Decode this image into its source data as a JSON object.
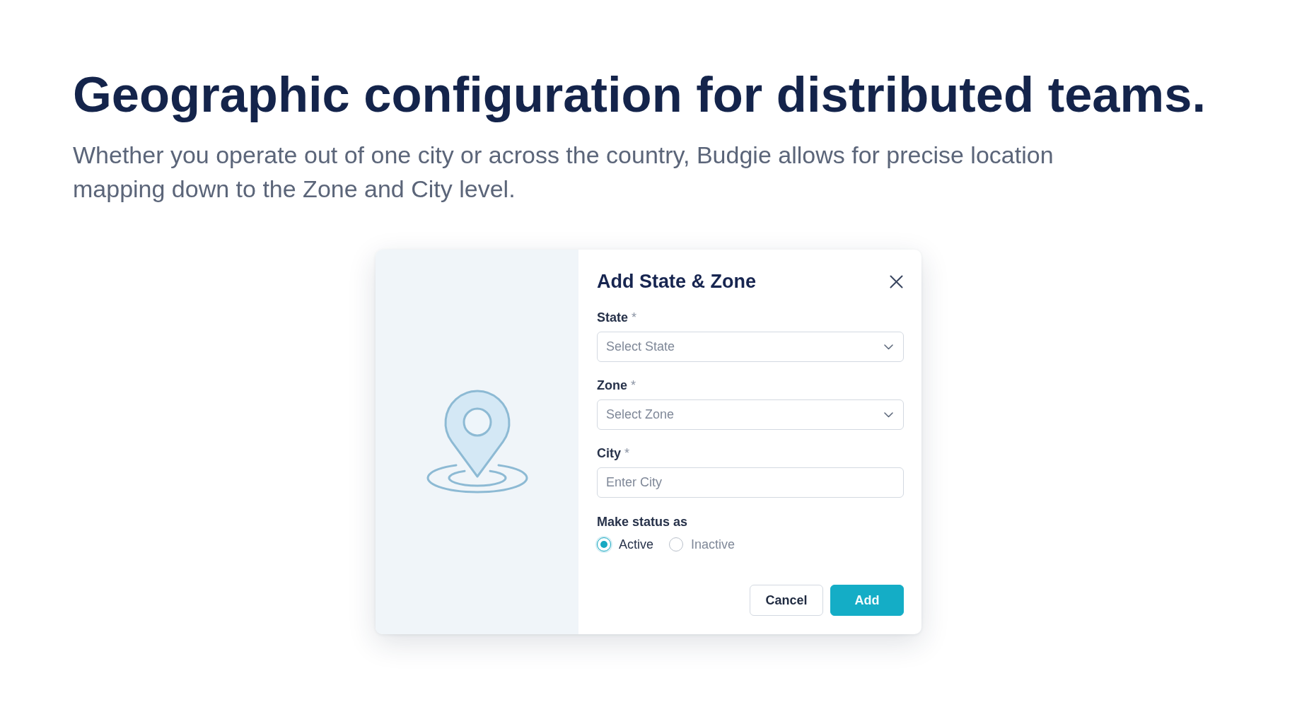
{
  "hero": {
    "title": "Geographic configuration for distributed teams.",
    "subtitle": "Whether you operate out of one city or across the country, Budgie allows for precise location mapping down to the Zone and City level."
  },
  "dialog": {
    "title": "Add State & Zone",
    "fields": [
      {
        "kind": "select",
        "label": "State",
        "required_mark": "*",
        "placeholder": "Select State"
      },
      {
        "kind": "select",
        "label": "Zone",
        "required_mark": "*",
        "placeholder": "Select Zone"
      },
      {
        "kind": "text",
        "label": "City",
        "required_mark": "*",
        "placeholder": "Enter City"
      }
    ],
    "status": {
      "label": "Make status as",
      "options": [
        {
          "label": "Active",
          "selected": true
        },
        {
          "label": "Inactive",
          "selected": false
        }
      ]
    },
    "buttons": [
      {
        "kind": "secondary",
        "label": "Cancel"
      },
      {
        "kind": "primary",
        "label": "Add"
      }
    ]
  }
}
